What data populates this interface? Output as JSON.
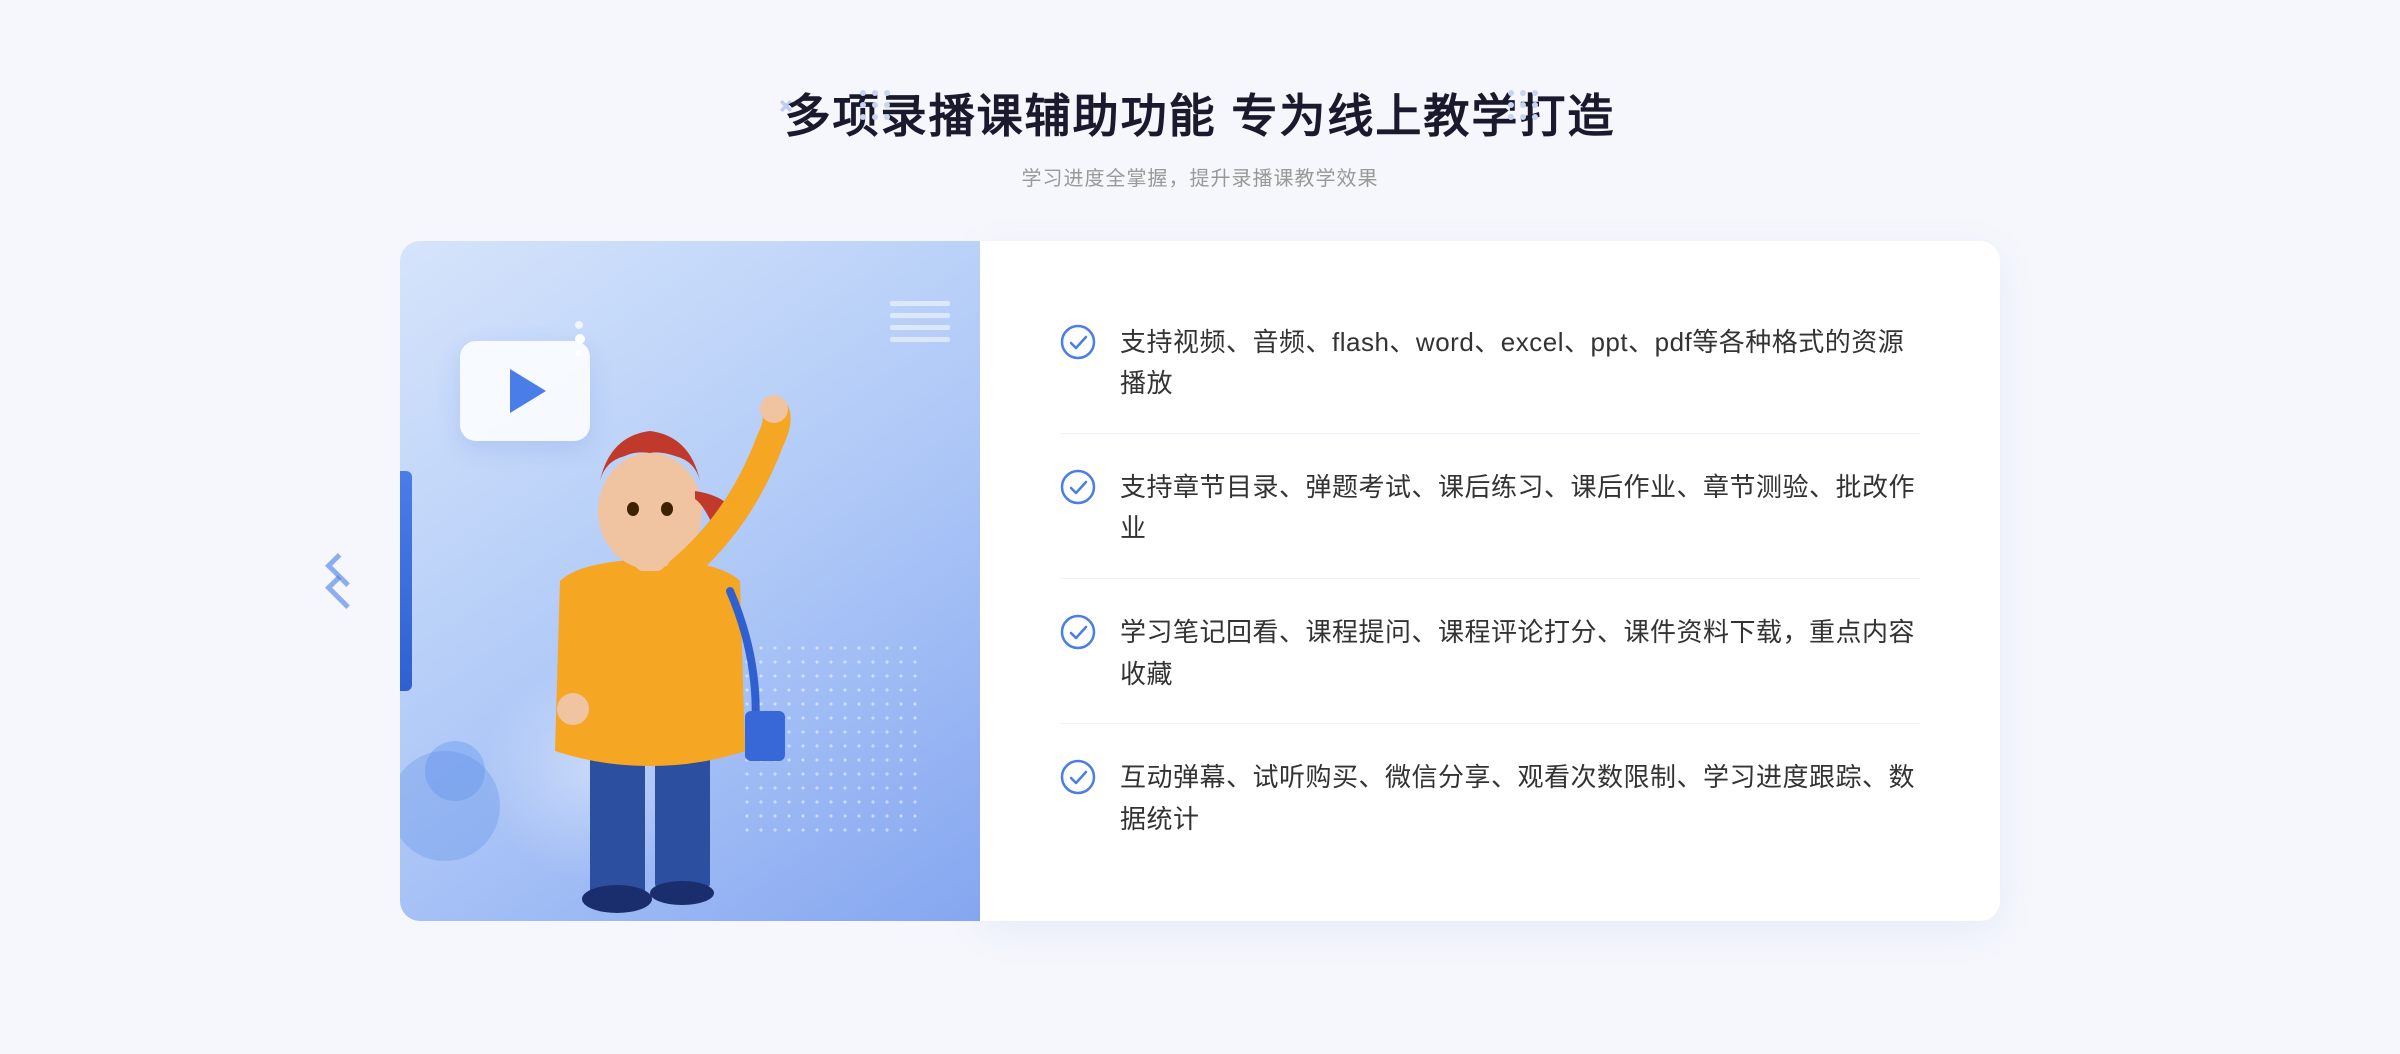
{
  "header": {
    "title": "多项录播课辅助功能 专为线上教学打造",
    "subtitle": "学习进度全掌握，提升录播课教学效果"
  },
  "features": [
    {
      "id": "feature-1",
      "text": "支持视频、音频、flash、word、excel、ppt、pdf等各种格式的资源播放"
    },
    {
      "id": "feature-2",
      "text": "支持章节目录、弹题考试、课后练习、课后作业、章节测验、批改作业"
    },
    {
      "id": "feature-3",
      "text": "学习笔记回看、课程提问、课程评论打分、课件资料下载，重点内容收藏"
    },
    {
      "id": "feature-4",
      "text": "互动弹幕、试听购买、微信分享、观看次数限制、学习进度跟踪、数据统计"
    }
  ],
  "icons": {
    "check": "check-circle-icon",
    "chevron": "chevron-right-icon",
    "play": "play-icon"
  },
  "colors": {
    "accent": "#4a7de8",
    "title": "#1a1a2e",
    "subtitle": "#999999",
    "text": "#333333",
    "bg": "#f5f7fc",
    "white": "#ffffff"
  }
}
